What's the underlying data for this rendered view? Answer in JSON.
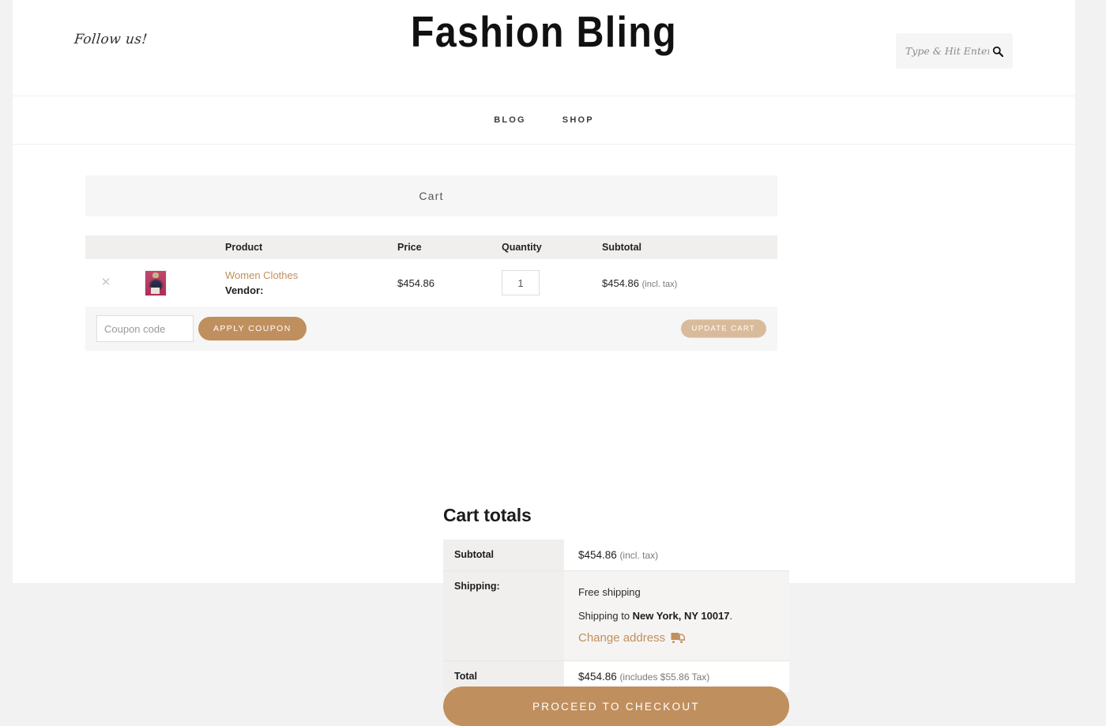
{
  "header": {
    "follow_label": "Follow us!",
    "site_title": "Fashion Bling",
    "search": {
      "placeholder": "Type & Hit Enter ...",
      "value": "",
      "icon": "search-icon"
    }
  },
  "nav": {
    "items": [
      {
        "label": "BLOG"
      },
      {
        "label": "SHOP"
      }
    ]
  },
  "cart": {
    "heading": "Cart",
    "columns": {
      "remove": "",
      "thumbnail": "",
      "product": "Product",
      "price": "Price",
      "quantity": "Quantity",
      "subtotal": "Subtotal"
    },
    "items": [
      {
        "remove_icon": "close-icon",
        "thumbnail_alt": "Women Clothes product thumbnail",
        "name": "Women Clothes",
        "vendor_label": "Vendor:",
        "vendor_value": "",
        "price": "$454.86",
        "quantity": "1",
        "subtotal": "$454.86",
        "subtotal_note": "(incl. tax)"
      }
    ],
    "coupon": {
      "placeholder": "Coupon code",
      "value": "",
      "apply_label": "APPLY COUPON",
      "update_label": "UPDATE CART"
    }
  },
  "totals": {
    "title": "Cart totals",
    "subtotal_label": "Subtotal",
    "subtotal_value": "$454.86",
    "subtotal_note": "(incl. tax)",
    "shipping_label": "Shipping:",
    "shipping_method": "Free shipping",
    "shipping_to_prefix": "Shipping to ",
    "shipping_destination": "New York, NY 10017",
    "shipping_to_suffix": ".",
    "change_address_label": "Change address",
    "change_address_icon": "delivery-truck-icon",
    "total_label": "Total",
    "total_value": "$454.86",
    "total_note": "(includes $55.86 Tax)"
  },
  "checkout": {
    "label": "PROCEED TO CHECKOUT"
  },
  "colors": {
    "accent": "#c08f5e",
    "accent_muted": "#d9bb9b",
    "header_row_bg": "#f0efed",
    "panel_bg": "#f6f6f6",
    "page_bg": "#f2f2f2",
    "text": "#1c1c1c",
    "text_muted": "#7a7a7a"
  }
}
